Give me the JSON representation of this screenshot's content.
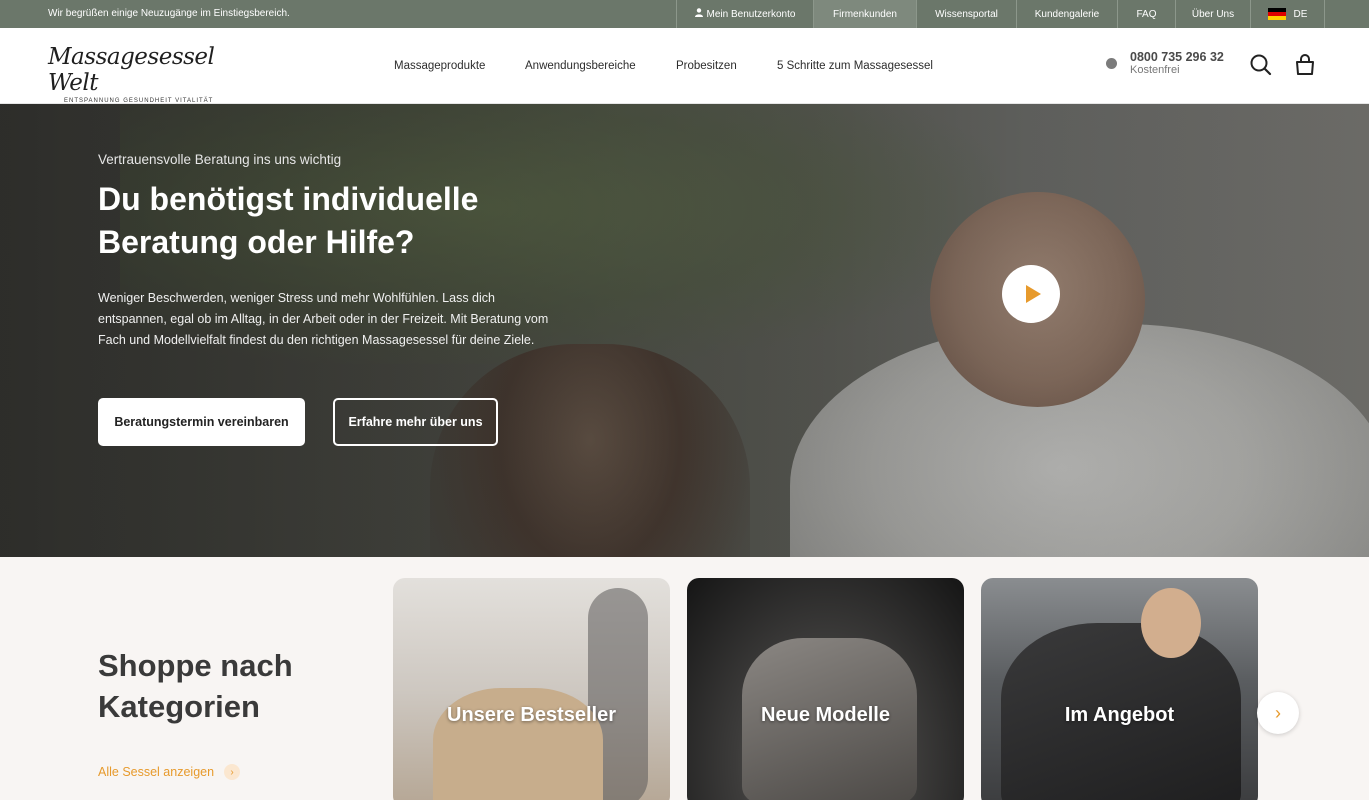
{
  "topbar": {
    "welcome": "Wir begrüßen einige Neuzugänge im Einstiegsbereich.",
    "links": [
      {
        "label": "Mein Benutzerkonto",
        "icon": "user-icon"
      },
      {
        "label": "Firmenkunden",
        "active": true
      },
      {
        "label": "Wissensportal"
      },
      {
        "label": "Kundengalerie"
      },
      {
        "label": "FAQ"
      },
      {
        "label": "Über Uns"
      },
      {
        "label": "DE",
        "icon": "flag-de-icon"
      }
    ]
  },
  "header": {
    "logo_script": "Massagesessel Welt",
    "logo_tagline": "ENTSPANNUNG GESUNDHEIT VITALITÄT",
    "nav": [
      "Massageprodukte",
      "Anwendungsbereiche",
      "Probesitzen",
      "5 Schritte zum Massagesessel"
    ],
    "phone": {
      "number": "0800 735 296 32",
      "note": "Kostenfrei"
    },
    "icons": [
      "search-icon",
      "cart-icon"
    ]
  },
  "hero": {
    "eyebrow": "Vertrauensvolle Beratung ins uns wichtig",
    "title": "Du benötigst individuelle Beratung oder Hilfe?",
    "description": "Weniger Beschwerden, weniger Stress und mehr Wohlfühlen. Lass dich entspannen, egal ob im Alltag, in der Arbeit oder in der Freizeit. Mit Beratung vom Fach und Modellvielfalt findest du den richtigen Massagesessel für deine Ziele.",
    "primary_button": "Beratungstermin vereinbaren",
    "secondary_button": "Erfahre mehr über uns"
  },
  "categories": {
    "title": "Shoppe nach Kategorien",
    "all_link": "Alle Sessel anzeigen",
    "cards": [
      "Unsere Bestseller",
      "Neue Modelle",
      "Im Angebot"
    ]
  },
  "colors": {
    "accent": "#e79a2c",
    "topbar": "#6b776a",
    "section_bg": "#f8f5f3"
  }
}
